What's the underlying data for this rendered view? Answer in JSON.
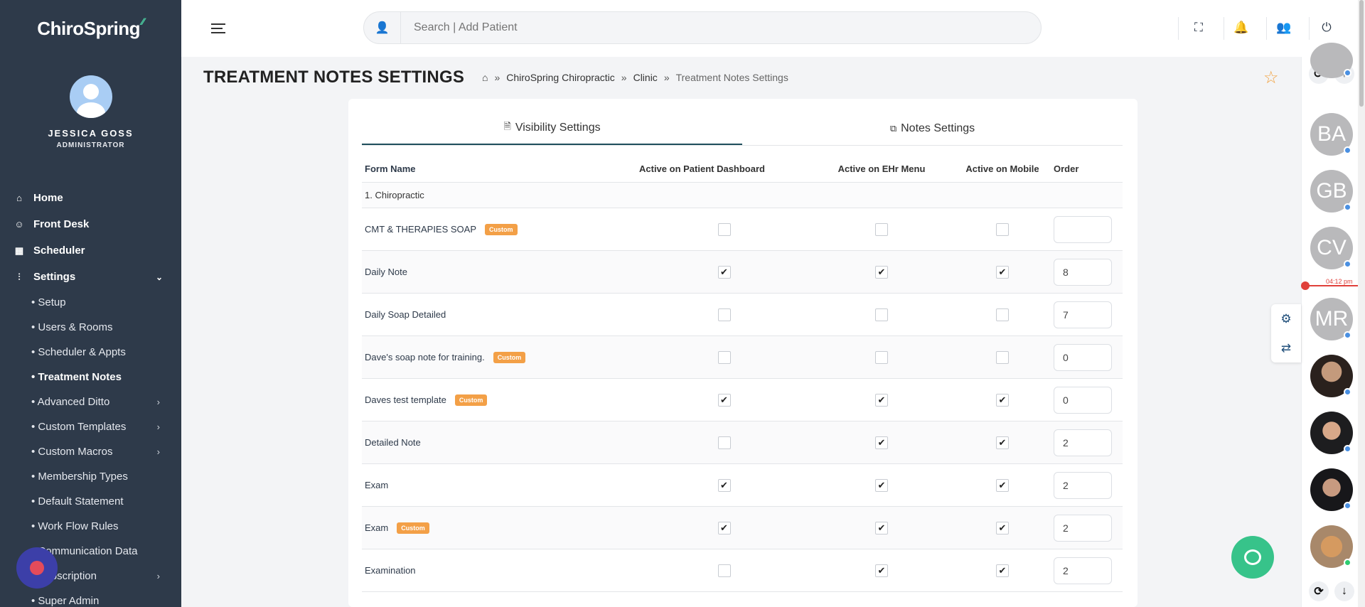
{
  "app": {
    "logo_text": "ChiroSpring"
  },
  "user": {
    "name": "JESSICA GOSS",
    "role": "ADMINISTRATOR"
  },
  "nav": {
    "main": [
      {
        "label": "Home",
        "icon": "home-icon"
      },
      {
        "label": "Front Desk",
        "icon": "user-check-icon"
      },
      {
        "label": "Scheduler",
        "icon": "calendar-icon"
      },
      {
        "label": "Settings",
        "icon": "sliders-icon"
      }
    ],
    "sub": [
      {
        "label": "• Setup"
      },
      {
        "label": "• Users & Rooms"
      },
      {
        "label": "• Scheduler & Appts"
      },
      {
        "label": "• Treatment Notes",
        "active": true
      },
      {
        "label": "• Advanced Ditto",
        "expandable": true
      },
      {
        "label": "• Custom Templates",
        "expandable": true
      },
      {
        "label": "• Custom Macros",
        "expandable": true
      },
      {
        "label": "• Membership Types"
      },
      {
        "label": "• Default Statement"
      },
      {
        "label": "• Work Flow Rules"
      },
      {
        "label": "• Communication Data"
      },
      {
        "label": "• Subscription",
        "expandable": true
      },
      {
        "label": "• Super Admin"
      }
    ]
  },
  "search": {
    "placeholder": "Search | Add Patient",
    "value": ""
  },
  "page": {
    "title": "TREATMENT NOTES SETTINGS"
  },
  "breadcrumb": {
    "sep": "»",
    "items": [
      "ChiroSpring Chiropractic",
      "Clinic"
    ],
    "current": "Treatment Notes Settings"
  },
  "tabs": [
    {
      "label": "Visibility Settings",
      "active": true
    },
    {
      "label": "Notes Settings",
      "active": false
    }
  ],
  "table": {
    "headers": [
      "Form Name",
      "Active on Patient Dashboard",
      "Active on EHr Menu",
      "Active on Mobile",
      "Order"
    ],
    "group": "1. Chiropractic",
    "badge_label": "Custom",
    "rows": [
      {
        "name": "CMT & THERAPIES SOAP",
        "custom": true,
        "dashboard": false,
        "ehr": false,
        "mobile": false,
        "order": ""
      },
      {
        "name": "Daily Note",
        "custom": false,
        "dashboard": true,
        "ehr": true,
        "mobile": true,
        "order": "8"
      },
      {
        "name": "Daily Soap Detailed",
        "custom": false,
        "dashboard": false,
        "ehr": false,
        "mobile": false,
        "order": "7"
      },
      {
        "name": "Dave's soap note for training.",
        "custom": true,
        "dashboard": false,
        "ehr": false,
        "mobile": false,
        "order": "0"
      },
      {
        "name": "Daves test template",
        "custom": true,
        "dashboard": true,
        "ehr": true,
        "mobile": true,
        "order": "0"
      },
      {
        "name": "Detailed Note",
        "custom": false,
        "dashboard": false,
        "ehr": true,
        "mobile": true,
        "order": "2"
      },
      {
        "name": "Exam",
        "custom": false,
        "dashboard": true,
        "ehr": true,
        "mobile": true,
        "order": "2"
      },
      {
        "name": "Exam",
        "custom": true,
        "dashboard": true,
        "ehr": true,
        "mobile": true,
        "order": "2"
      },
      {
        "name": "Examination",
        "custom": false,
        "dashboard": false,
        "ehr": true,
        "mobile": true,
        "order": "2"
      }
    ]
  },
  "rail": {
    "time_label": "04:12 pm",
    "patients": [
      {
        "initials": "BA",
        "status": "blue"
      },
      {
        "initials": "GB",
        "status": "blue"
      },
      {
        "initials": "CV",
        "status": "blue"
      },
      {
        "initials": "MR",
        "status": "blue"
      }
    ]
  },
  "colors": {
    "sidebar": "#2e3a4a",
    "accent": "#1f4e5b",
    "badge": "#f3a047",
    "chat": "#37c38a",
    "time_marker": "#e0403a"
  }
}
